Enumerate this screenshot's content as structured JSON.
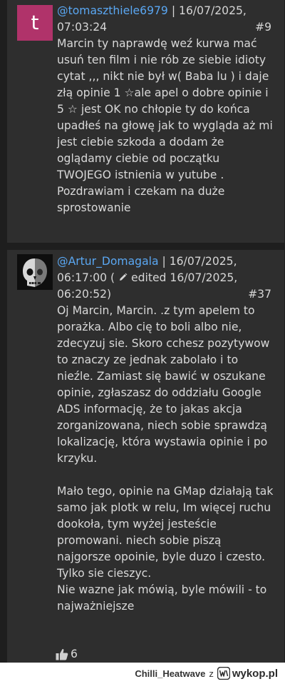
{
  "comments": [
    {
      "avatar_letter": "t",
      "username": "@tomaszthiele6979",
      "separator": "|",
      "date": "16/07/2025,",
      "time": "07:03:24",
      "post_number": "#9",
      "text": "Marcin ty naprawdę weź kurwa mać usuń ten film i nie rób ze siebie idioty cytat ,,, nikt nie był w( Baba lu ) i daje złą opinie 1 ☆ale apel o dobre opinie i 5 ☆ jest OK no chłopie ty do końca upadłeś na głowę jak to wygląda aż mi jest ciebie szkoda a dodam że oglądamy ciebie od początku TWOJEGO istnienia w yutube . Pozdrawiam i czekam na duże sprostowanie"
    },
    {
      "username": "@Artur_Domagala",
      "separator": "|",
      "date": "16/07/2025,",
      "time": "06:17:00 (",
      "edited_label": "edited 16/07/2025,",
      "edited_time": "06:20:52)",
      "post_number": "#37",
      "text": "Oj Marcin, Marcin. .z tym apelem to porażka. Albo cię to boli albo nie, zdecyzuj sie. Skoro cchesz pozytywow to znaczy ze jednak zabolało i to nieźle. Zamiast się bawić w oszukane opinie, zgłaszasz do oddziału Google ADS informację, że to jakas akcja zorganizowana, niech sobie sprawdzą lokalizację, która wystawia opinie i po krzyku.\n\nMało tego, opinie na GMap działają tak samo jak plotk w relu, Im więcej ruchu dookoła, tym wyżej jesteście promowani. niech sobie piszą najgorsze opoinie, byle duzo i czesto. Tylko sie cieszyc.\nNie wazne jak mówią, byle mówili - to najważniejsze",
      "likes": "6"
    }
  ],
  "footer": {
    "user": "Chilli_Heatwave",
    "connector": "z",
    "site": "wykop.pl"
  },
  "colors": {
    "background": "#1e1e1e",
    "card": "#2e2e2e",
    "username": "#5aa7f2",
    "avatar": "#b0336a"
  },
  "icons": [
    "pencil-icon",
    "thumbs-up-icon",
    "wykop-logo-icon"
  ]
}
